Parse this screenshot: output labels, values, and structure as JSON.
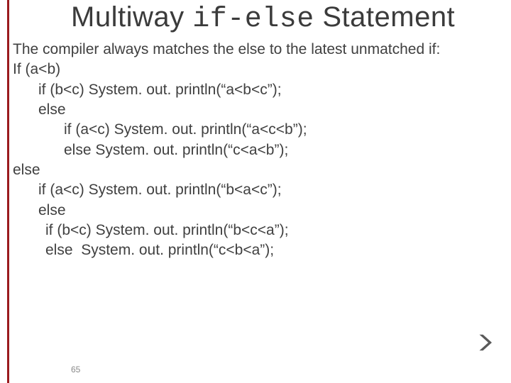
{
  "title": {
    "pre": "Multiway ",
    "mono": "if-else",
    "post": " Statement"
  },
  "lines": {
    "l0": "The compiler always matches the else to the latest unmatched if:",
    "l1": "If (a<b)",
    "l2": "if (b<c) System. out. println(“a<b<c”);",
    "l3": "else",
    "l4": "if (a<c) System. out. println(“a<c<b”);",
    "l5": "else System. out. println(“c<a<b”);",
    "l6": "else",
    "l7": "if (a<c) System. out. println(“b<a<c”);",
    "l8": "else",
    "l9": "if (b<c) System. out. println(“b<c<a”);",
    "l10": "else  System. out. println(“c<b<a”);"
  },
  "page_number": "65"
}
